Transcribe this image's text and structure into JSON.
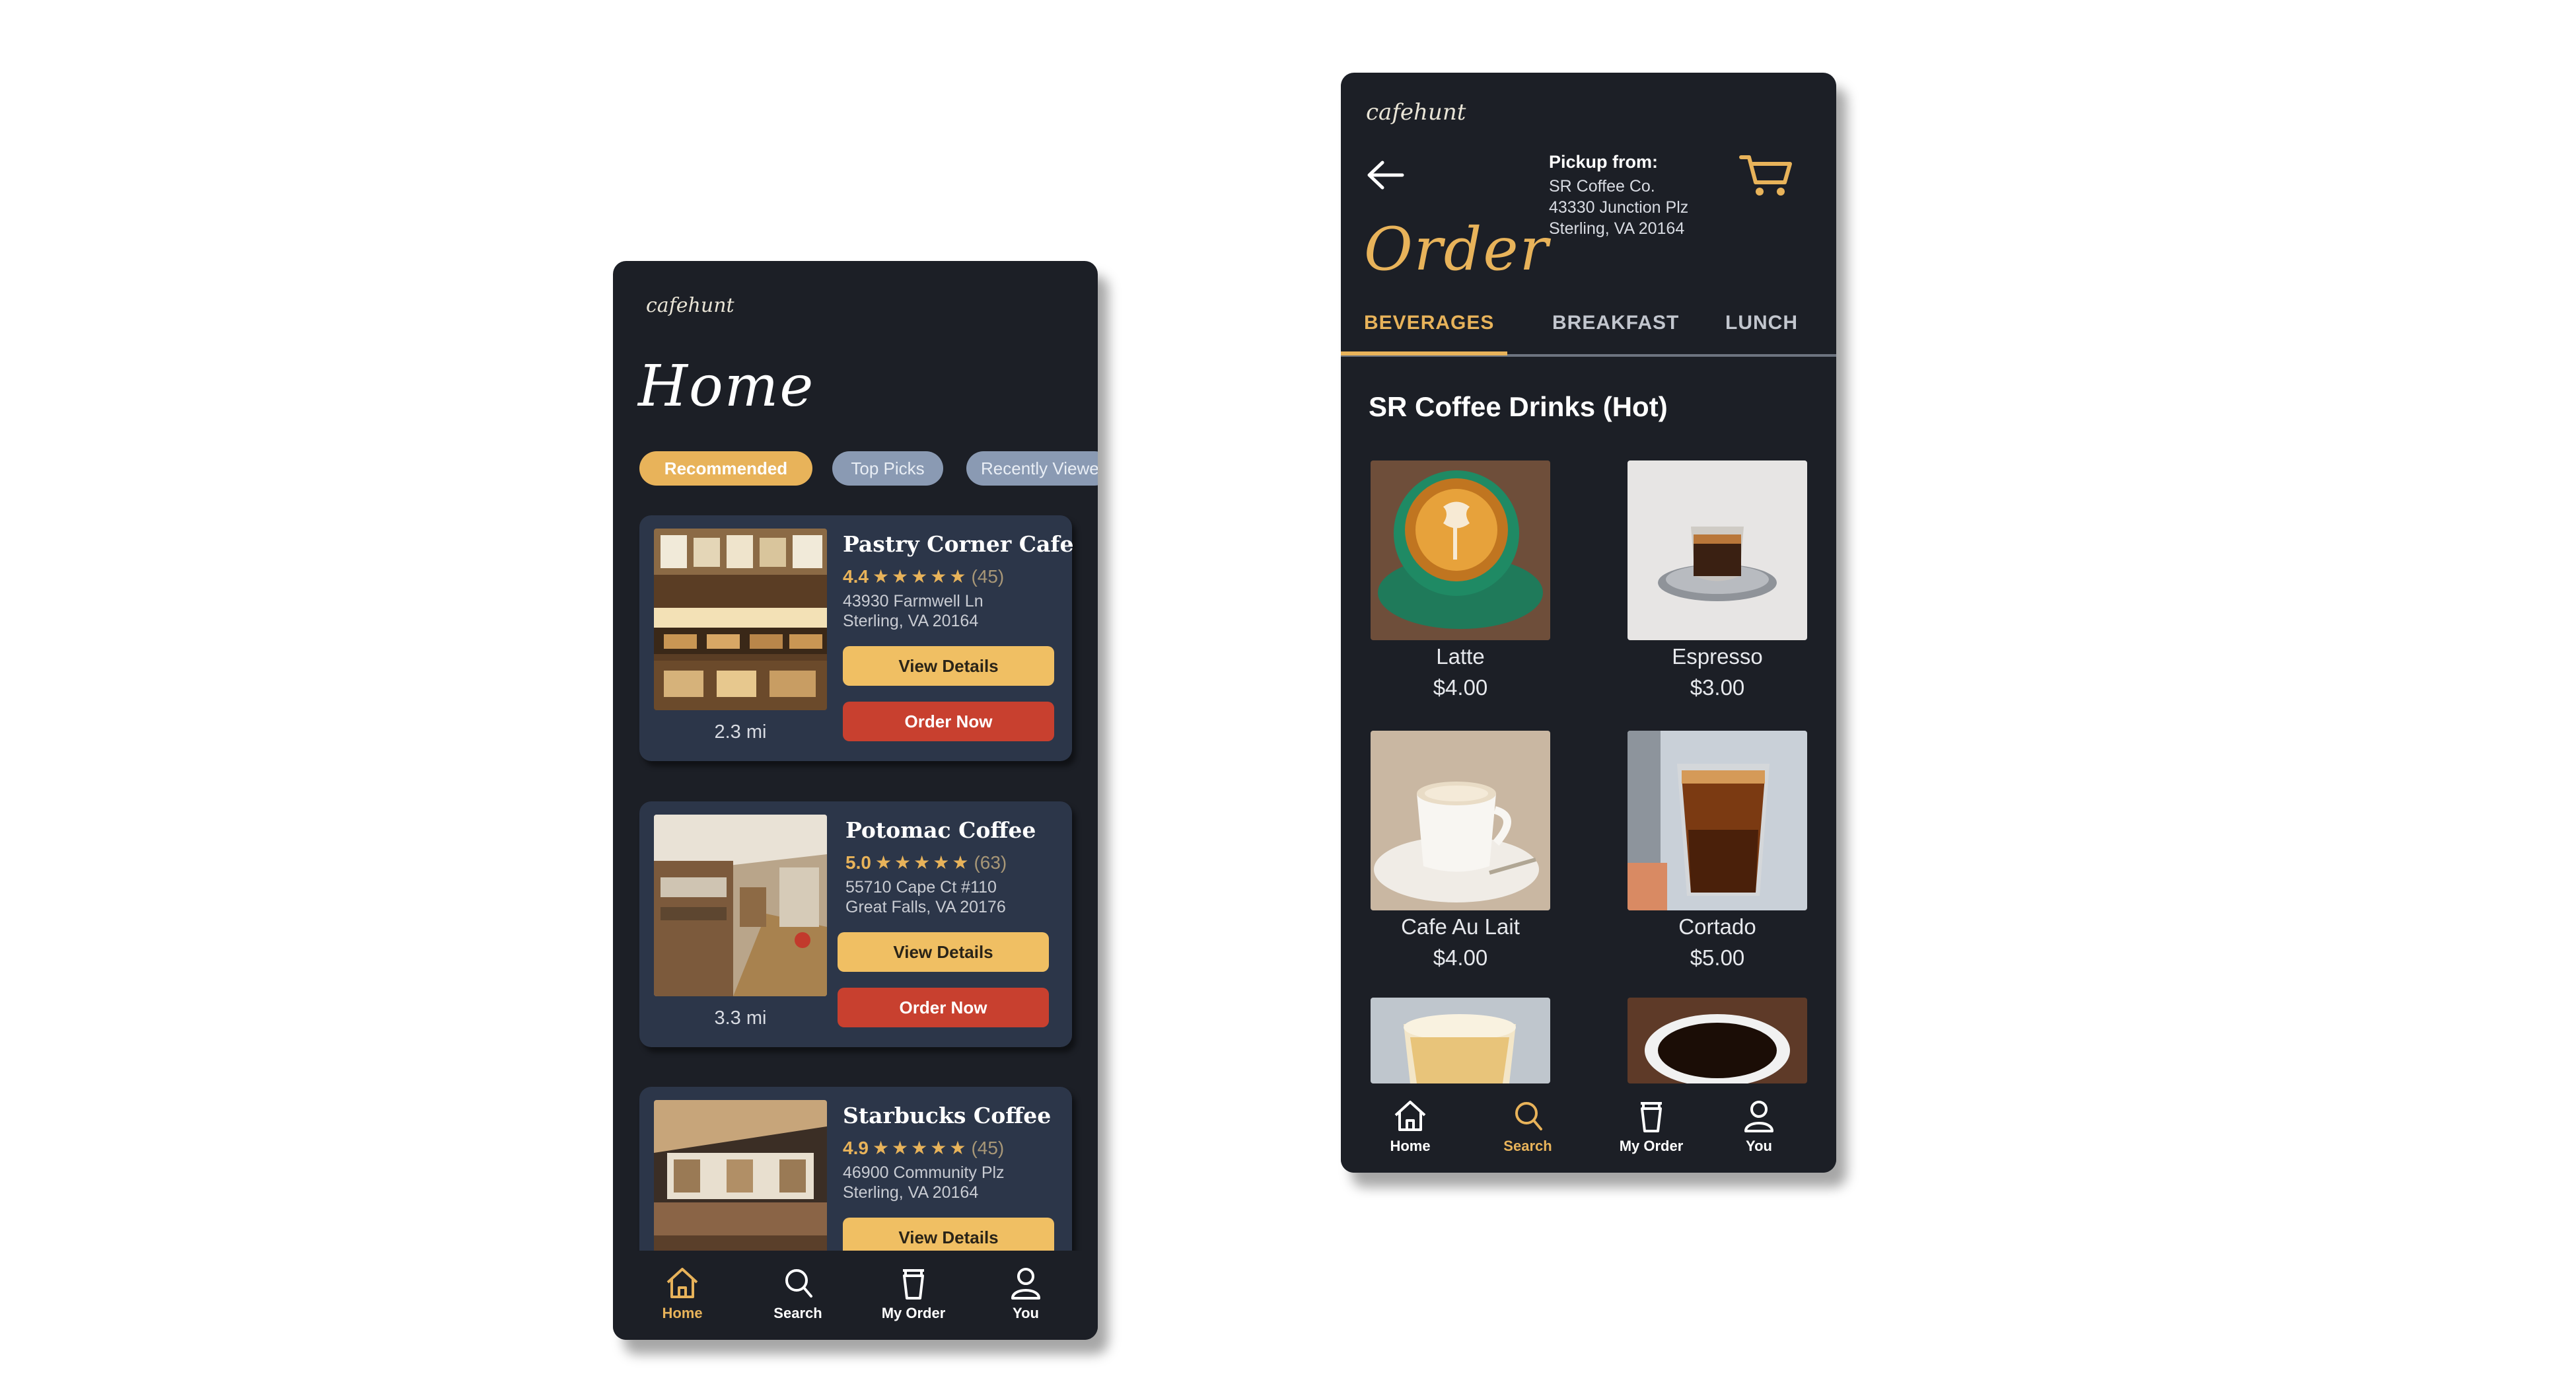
{
  "home": {
    "logo": "cafehunt",
    "title": "Home",
    "filters": [
      {
        "label": "Recommended",
        "active": true
      },
      {
        "label": "Top Picks",
        "active": false
      },
      {
        "label": "Recently Viewed",
        "active": false
      }
    ],
    "cafes": [
      {
        "name": "Pastry Corner Cafe",
        "rating": "4.4",
        "stars": "★★★★★",
        "count": "(45)",
        "addr1": "43930 Farmwell Ln",
        "addr2": "Sterling, VA 20164",
        "distance": "2.3 mi",
        "view_label": "View Details",
        "order_label": "Order Now"
      },
      {
        "name": "Potomac Coffee",
        "rating": "5.0",
        "stars": "★★★★★",
        "count": "(63)",
        "addr1": "55710 Cape Ct #110",
        "addr2": "Great Falls, VA 20176",
        "distance": "3.3 mi",
        "view_label": "View Details",
        "order_label": "Order Now"
      },
      {
        "name": "Starbucks Coffee",
        "rating": "4.9",
        "stars": "★★★★★",
        "count": "(45)",
        "addr1": "46900 Community Plz",
        "addr2": "Sterling, VA 20164",
        "view_label": "View Details"
      }
    ],
    "nav": [
      {
        "label": "Home",
        "icon": "home-icon",
        "active": true
      },
      {
        "label": "Search",
        "icon": "search-icon",
        "active": false
      },
      {
        "label": "My Order",
        "icon": "cup-icon",
        "active": false
      },
      {
        "label": "You",
        "icon": "user-icon",
        "active": false
      }
    ]
  },
  "order": {
    "logo": "cafehunt",
    "title": "Order",
    "pickup": {
      "heading": "Pickup from:",
      "line1": "SR Coffee Co.",
      "line2": "43330 Junction Plz",
      "line3": "Sterling, VA 20164"
    },
    "tabs": [
      {
        "label": "BEVERAGES",
        "active": true
      },
      {
        "label": "BREAKFAST",
        "active": false
      },
      {
        "label": "LUNCH",
        "active": false
      }
    ],
    "section_title": "SR Coffee Drinks (Hot)",
    "items": [
      {
        "name": "Latte",
        "price": "$4.00"
      },
      {
        "name": "Espresso",
        "price": "$3.00"
      },
      {
        "name": "Cafe Au Lait",
        "price": "$4.00"
      },
      {
        "name": "Cortado",
        "price": "$5.00"
      }
    ],
    "nav": [
      {
        "label": "Home",
        "icon": "home-icon",
        "active": false
      },
      {
        "label": "Search",
        "icon": "search-icon",
        "active": true
      },
      {
        "label": "My Order",
        "icon": "cup-icon",
        "active": false
      },
      {
        "label": "You",
        "icon": "user-icon",
        "active": false
      }
    ]
  },
  "colors": {
    "accent": "#e8b35a",
    "background": "#1c1f26",
    "card": "#2c3649",
    "order_button": "#c8402f"
  }
}
